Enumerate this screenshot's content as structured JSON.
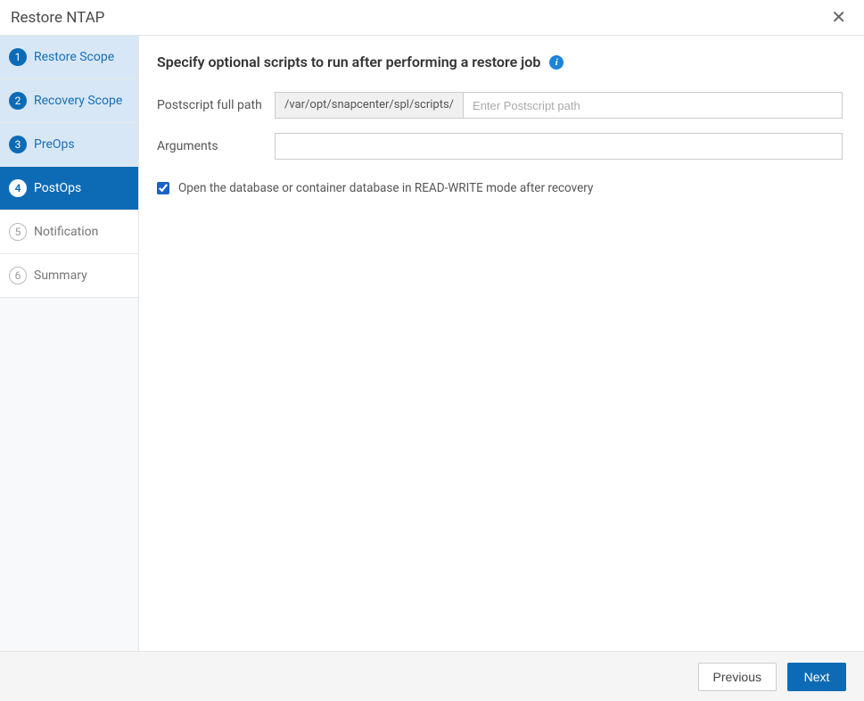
{
  "dialog": {
    "title": "Restore NTAP",
    "close_symbol": "✕"
  },
  "wizard": {
    "steps": [
      {
        "num": "1",
        "label": "Restore Scope",
        "state": "completed"
      },
      {
        "num": "2",
        "label": "Recovery Scope",
        "state": "completed"
      },
      {
        "num": "3",
        "label": "PreOps",
        "state": "completed"
      },
      {
        "num": "4",
        "label": "PostOps",
        "state": "active"
      },
      {
        "num": "5",
        "label": "Notification",
        "state": "pending"
      },
      {
        "num": "6",
        "label": "Summary",
        "state": "pending"
      }
    ]
  },
  "content": {
    "heading": "Specify optional scripts to run after performing a restore job",
    "info_symbol": "i",
    "postscript_label": "Postscript full path",
    "postscript_prefix": "/var/opt/snapcenter/spl/scripts/",
    "postscript_placeholder": "Enter Postscript path",
    "postscript_value": "",
    "arguments_label": "Arguments",
    "arguments_value": "",
    "checkbox_label": "Open the database or container database in READ-WRITE mode after recovery",
    "checkbox_checked": true
  },
  "footer": {
    "previous": "Previous",
    "next": "Next"
  }
}
